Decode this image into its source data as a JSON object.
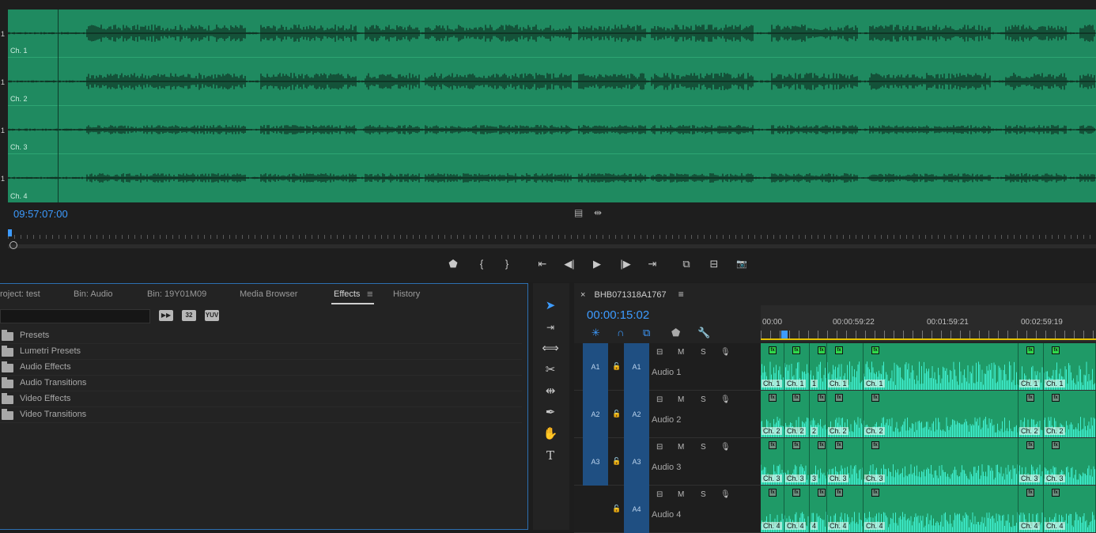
{
  "source": {
    "channel_marker": "1",
    "channels": [
      {
        "label": "Ch. 1"
      },
      {
        "label": "Ch. 2"
      },
      {
        "label": "Ch. 3"
      },
      {
        "label": "Ch. 4"
      }
    ],
    "timecode": "09:57:07:00",
    "colors": {
      "waveform_bg": "#1f8a60",
      "timecode": "#3d9bff"
    }
  },
  "transport": {
    "icons": [
      "marker-icon",
      "mark-in-icon",
      "mark-out-icon",
      "go-to-in-icon",
      "step-back-icon",
      "play-icon",
      "step-forward-icon",
      "go-to-out-icon",
      "insert-icon",
      "overwrite-icon",
      "export-frame-icon"
    ],
    "glyphs": {
      "marker": "⬟",
      "mark_in": "{",
      "mark_out": "}",
      "go_in": "⇤",
      "step_back": "◀|",
      "play": "▶",
      "step_fwd": "|▶",
      "go_out": "⇥",
      "insert": "⧉",
      "overwrite": "⊟",
      "camera": "📷"
    }
  },
  "project": {
    "tabs": [
      "roject: test",
      "Bin: Audio",
      "Bin: 19Y01M09",
      "Media Browser",
      "Effects",
      "History"
    ],
    "active_tab": "Effects",
    "menu_glyph": "≡",
    "filter_buttons": [
      "32",
      "YUV"
    ],
    "tree": [
      "Presets",
      "Lumetri Presets",
      "Audio Effects",
      "Audio Transitions",
      "Video Effects",
      "Video Transitions"
    ]
  },
  "tools": {
    "icons": [
      "selection-tool-icon",
      "track-select-tool-icon",
      "ripple-edit-tool-icon",
      "razor-tool-icon",
      "slip-tool-icon",
      "pen-tool-icon",
      "hand-tool-icon",
      "type-tool-icon"
    ],
    "glyphs": [
      "➤",
      "⇥",
      "⟺",
      "✂",
      "⇹",
      "✒",
      "✋",
      "T"
    ]
  },
  "timeline": {
    "close_glyph": "×",
    "sequence_name": "BHB071318A1767",
    "menu_glyph": "≡",
    "timecode": "00:00:15:02",
    "ruler_labels": [
      "00:00",
      "00:00:59:22",
      "00:01:59:21",
      "00:02:59:19"
    ],
    "tracks": [
      {
        "src": "A1",
        "patch": "A1",
        "name": "Audio 1",
        "ch": "Ch. 1",
        "ch_short": "1",
        "fx_on": true
      },
      {
        "src": "A2",
        "patch": "A2",
        "name": "Audio 2",
        "ch": "Ch. 2",
        "ch_short": "2",
        "fx_on": false
      },
      {
        "src": "A3",
        "patch": "A3",
        "name": "Audio 3",
        "ch": "Ch. 3",
        "ch_short": "3",
        "fx_on": false
      },
      {
        "src": "",
        "patch": "A4",
        "name": "Audio 4",
        "ch": "Ch. 4",
        "ch_short": "4",
        "fx_on": false
      }
    ],
    "track_buttons": {
      "mute": "M",
      "solo": "S"
    },
    "colors": {
      "clip": "#1f9a67",
      "wave": "#3ff0d0",
      "patch": "#1f4f82",
      "work_area": "#e3c000"
    }
  }
}
